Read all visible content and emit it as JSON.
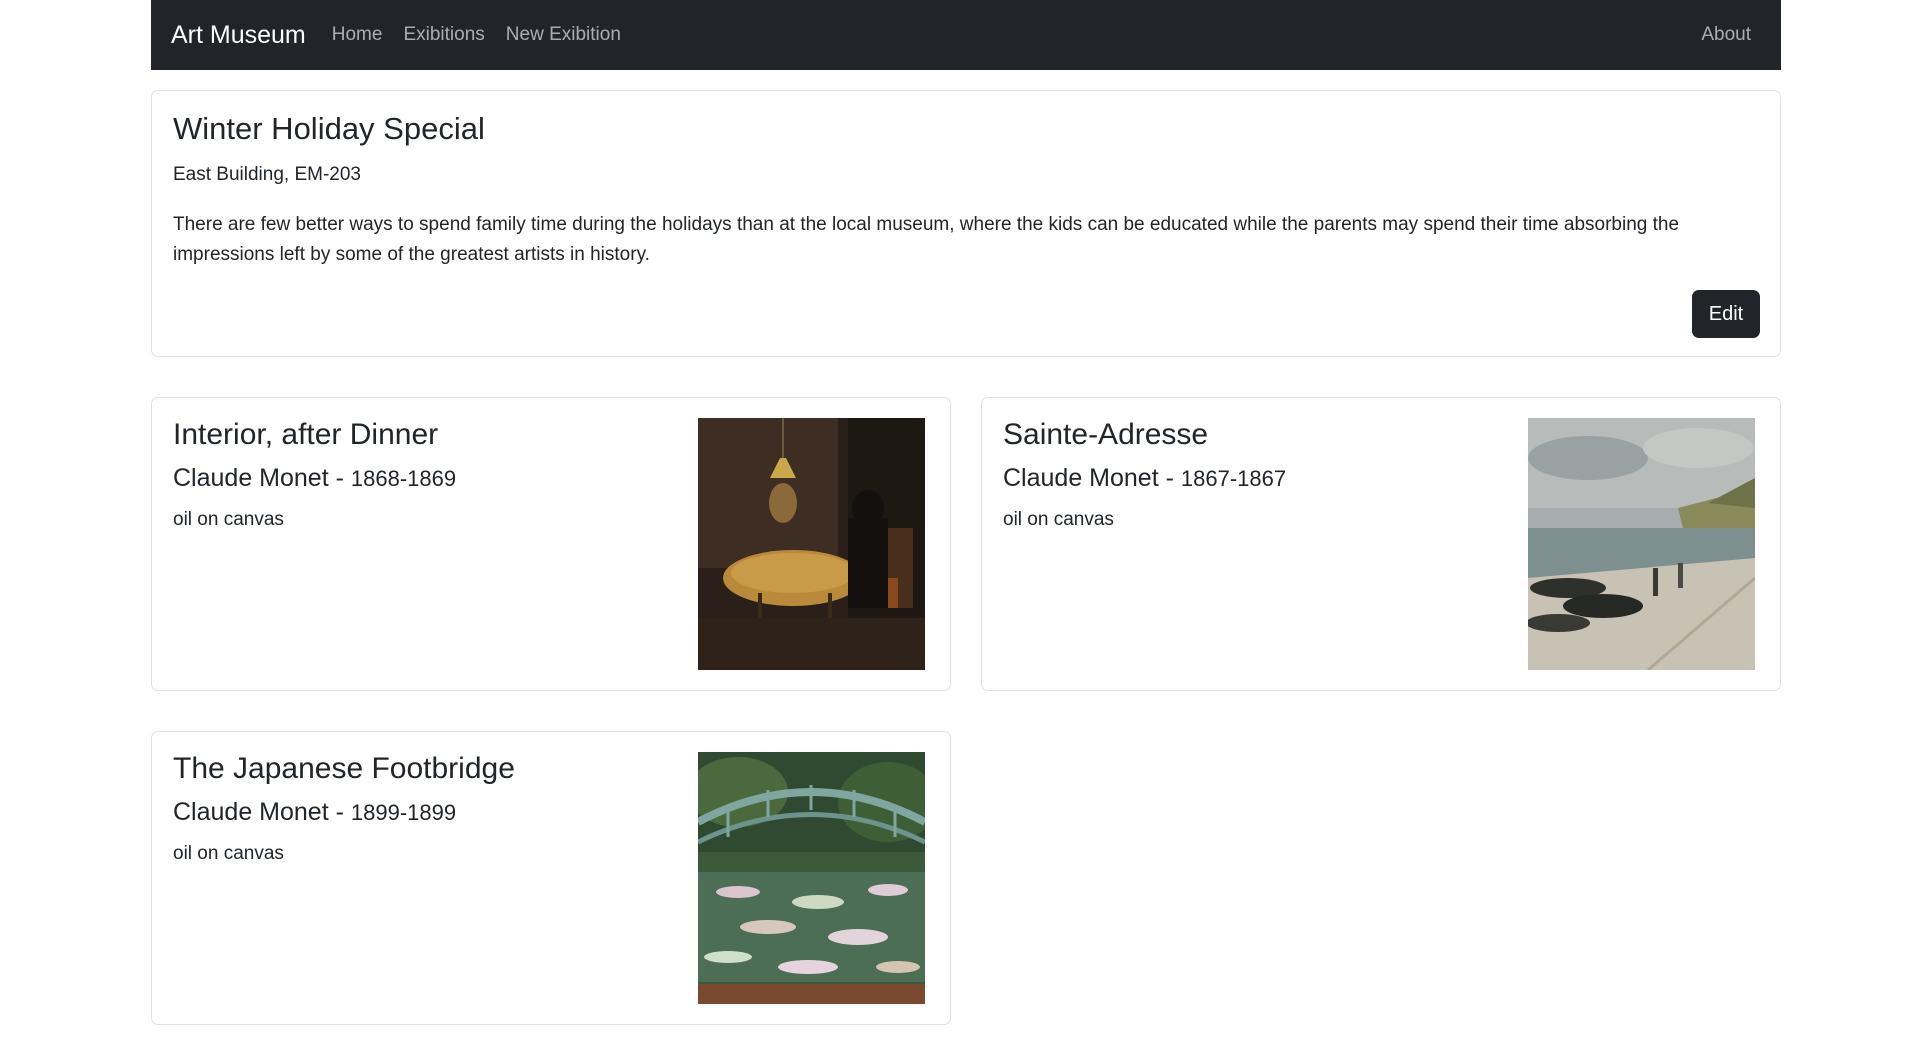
{
  "navbar": {
    "brand": "Art Museum",
    "links": [
      "Home",
      "Exibitions",
      "New Exibition"
    ],
    "about": "About"
  },
  "exhibition": {
    "title": "Winter Holiday Special",
    "location": "East Building, EM-203",
    "description": "There are few better ways to spend family time during the holidays than at the local museum, where the kids can be educated while the parents may spend their time absorbing the impressions left by some of the greatest artists in history.",
    "edit_label": "Edit"
  },
  "artworks": [
    {
      "title": "Interior, after Dinner",
      "artist": "Claude Monet",
      "separator": " - ",
      "dates": "1868-1869",
      "medium": "oil on canvas"
    },
    {
      "title": "Sainte-Adresse",
      "artist": "Claude Monet",
      "separator": " - ",
      "dates": "1867-1867",
      "medium": "oil on canvas"
    },
    {
      "title": "The Japanese Footbridge",
      "artist": "Claude Monet",
      "separator": " - ",
      "dates": "1899-1899",
      "medium": "oil on canvas"
    }
  ],
  "colors": {
    "navbar_bg": "#212529",
    "button_bg": "#212529",
    "card_border": "#dee2e6"
  }
}
